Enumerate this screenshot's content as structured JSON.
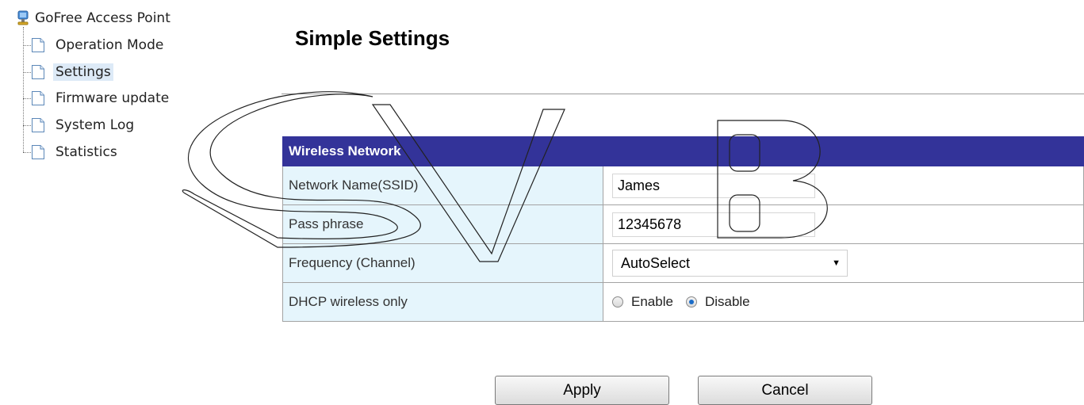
{
  "sidebar": {
    "root_label": "GoFree Access Point",
    "items": [
      {
        "label": "Operation Mode",
        "selected": false
      },
      {
        "label": "Settings",
        "selected": true
      },
      {
        "label": "Firmware update",
        "selected": false
      },
      {
        "label": "System Log",
        "selected": false
      },
      {
        "label": "Statistics",
        "selected": false
      }
    ]
  },
  "main": {
    "title": "Simple Settings",
    "section_header": "Wireless Network",
    "fields": {
      "ssid": {
        "label": "Network Name(SSID)",
        "value": "James"
      },
      "passphrase": {
        "label": "Pass phrase",
        "value": "12345678"
      },
      "frequency": {
        "label": "Frequency (Channel)",
        "value": "AutoSelect"
      },
      "dhcp": {
        "label": "DHCP wireless only",
        "option_enable": "Enable",
        "option_disable": "Disable",
        "selected": "Disable"
      }
    },
    "buttons": {
      "apply": "Apply",
      "cancel": "Cancel"
    }
  },
  "watermark_text": "SVB",
  "colors": {
    "section_header_bg": "#333399",
    "label_cell_bg": "#e5f5fc",
    "selected_item_bg": "#ddeaf7"
  }
}
